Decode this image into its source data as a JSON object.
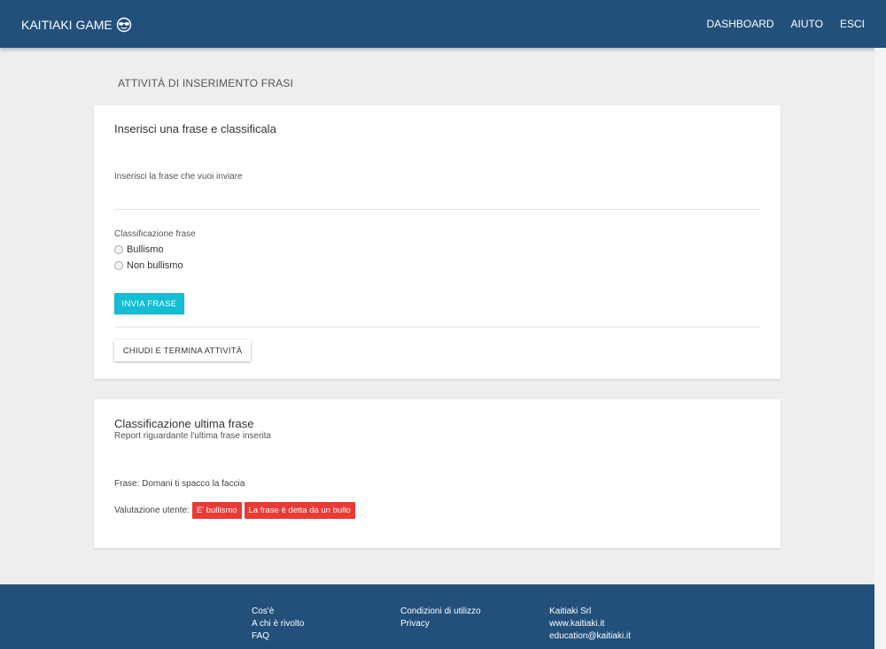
{
  "header": {
    "brand": "KAITIAKI GAME",
    "brand_icon": "sunglasses-face-icon",
    "nav": {
      "dashboard": "DASHBOARD",
      "help": "AIUTO",
      "exit": "ESCI"
    }
  },
  "page": {
    "title": "ATTIVITÀ DI INSERIMENTO FRASI"
  },
  "insert_card": {
    "title": "Inserisci una frase e classificala",
    "input_label": "Inserisci la frase che vuoi inviare",
    "input_value": "",
    "classification_label": "Classificazione frase",
    "options": [
      "Bullismo",
      "Non bullismo"
    ],
    "submit_label": "INVIA FRASE",
    "close_label": "CHIUDI E TERMINA ATTIVITÀ"
  },
  "result_card": {
    "title": "Classificazione ultima frase",
    "subtitle": "Report riguardante l'ultima frase inserita",
    "phrase_line": "Frase: Domani ti spacco la faccia",
    "evaluation_label": "Valutazione utente:",
    "badges": [
      "E' bullismo",
      "La frase è detta da un bullo"
    ]
  },
  "footer": {
    "col1": [
      "Cos'è",
      "A chi è rivolto",
      "FAQ"
    ],
    "col2": [
      "Condizioni di utilizzo",
      "Privacy"
    ],
    "col3": [
      "Kaitiaki Srl",
      "www.kaitiaki.it",
      "education@kaitiaki.it"
    ]
  },
  "colors": {
    "header": "#22507b",
    "accent": "#14bdd4",
    "badge": "#e93a35",
    "background": "#eeeeee"
  }
}
